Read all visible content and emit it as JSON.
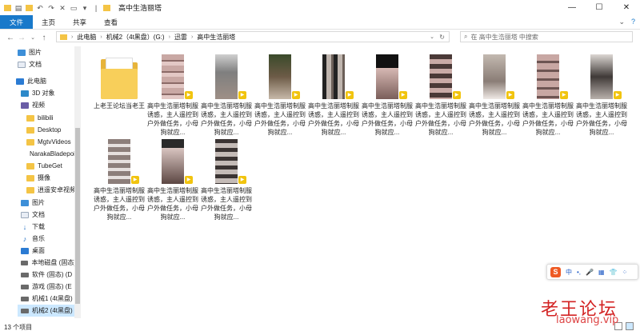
{
  "window": {
    "title": "高中生浩丽塔",
    "buttons": [
      "—",
      "☐",
      "✕"
    ]
  },
  "ribbon": {
    "tabs": [
      "文件",
      "主页",
      "共享",
      "查看"
    ]
  },
  "address": {
    "crumbs": [
      "此电脑",
      "机械2（4t黑盘）(G:)",
      "迅雷",
      "高中生浩丽塔"
    ],
    "search_placeholder": "在 高中生浩丽塔 中搜索"
  },
  "sidebar": {
    "items": [
      {
        "label": "图片",
        "icon": "picture-icon"
      },
      {
        "label": "文档",
        "icon": "document-icon"
      },
      {
        "label": "此电脑",
        "icon": "computer-icon"
      },
      {
        "label": "3D 对象",
        "icon": "3d-objects-icon"
      },
      {
        "label": "视频",
        "icon": "video-icon"
      },
      {
        "label": "bilibili",
        "icon": "folder-icon"
      },
      {
        "label": "Desktop",
        "icon": "folder-icon"
      },
      {
        "label": "MgtvVideos",
        "icon": "folder-icon"
      },
      {
        "label": "NarakaBladepoint",
        "icon": "folder-icon"
      },
      {
        "label": "TubeGet",
        "icon": "folder-icon"
      },
      {
        "label": "摄像",
        "icon": "folder-icon"
      },
      {
        "label": "逍遥安卓视频",
        "icon": "folder-icon"
      },
      {
        "label": "图片",
        "icon": "picture-icon"
      },
      {
        "label": "文档",
        "icon": "document-icon"
      },
      {
        "label": "下载",
        "icon": "download-icon"
      },
      {
        "label": "音乐",
        "icon": "music-icon"
      },
      {
        "label": "桌面",
        "icon": "desktop-icon"
      },
      {
        "label": "本地磁盘 (固态)",
        "icon": "drive-icon"
      },
      {
        "label": "软件 (固态) (D",
        "icon": "drive-icon"
      },
      {
        "label": "游戏 (固态) (E",
        "icon": "drive-icon"
      },
      {
        "label": "机械1 (4t黑盘)",
        "icon": "drive-icon"
      },
      {
        "label": "机械2 (4t黑盘)",
        "icon": "drive-icon"
      }
    ]
  },
  "files": [
    {
      "type": "folder",
      "name": "上老王论坛当老王"
    },
    {
      "type": "video",
      "name": "高中生浩丽塔制服诱惑，主人遥控到户外做任务，小母狗就应..."
    },
    {
      "type": "video",
      "name": "高中生浩丽塔制服诱惑，主人遥控到户外做任务，小母狗就应..."
    },
    {
      "type": "video",
      "name": "高中生浩丽塔制服诱惑，主人遥控到户外做任务，小母狗就应..."
    },
    {
      "type": "video",
      "name": "高中生浩丽塔制服诱惑，主人遥控到户外做任务，小母狗就应..."
    },
    {
      "type": "video",
      "name": "高中生浩丽塔制服诱惑，主人遥控到户外做任务，小母狗就应..."
    },
    {
      "type": "video",
      "name": "高中生浩丽塔制服诱惑，主人遥控到户外做任务，小母狗就应..."
    },
    {
      "type": "video",
      "name": "高中生浩丽塔制服诱惑，主人遥控到户外做任务，小母狗就应..."
    },
    {
      "type": "video",
      "name": "高中生浩丽塔制服诱惑，主人遥控到户外做任务，小母狗就应..."
    },
    {
      "type": "video",
      "name": "高中生浩丽塔制服诱惑，主人遥控到户外做任务，小母狗就应..."
    },
    {
      "type": "video",
      "name": "高中生浩丽塔制服诱惑，主人遥控到户外做任务，小母狗就应..."
    },
    {
      "type": "video",
      "name": "高中生浩丽塔制服诱惑，主人遥控到户外做任务，小母狗就应..."
    },
    {
      "type": "video",
      "name": "高中生浩丽塔制服诱惑，主人遥控到户外做任务，小母狗就应..."
    }
  ],
  "status": {
    "count": "13 个项目"
  },
  "ime": {
    "logo": "S",
    "items": [
      "中",
      "•,",
      "🎤",
      "▦",
      "👕",
      "⁘"
    ]
  },
  "watermark": {
    "text": "老王论坛",
    "url": "laowang.vip"
  },
  "colors": {
    "accent": "#1979ca",
    "selected": "#cce8ff",
    "folder": "#f4c445",
    "watermark": "#d32323"
  }
}
